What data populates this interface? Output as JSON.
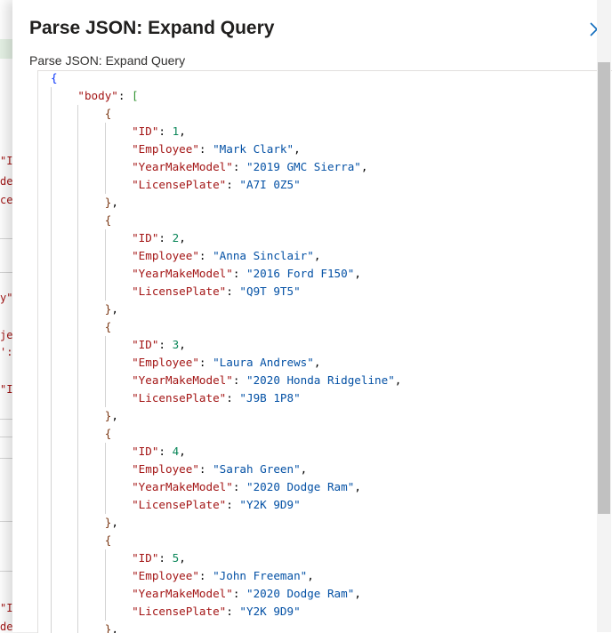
{
  "dialog": {
    "title": "Parse JSON: Expand Query",
    "field_label": "Parse JSON: Expand Query",
    "close_icon": "close-icon"
  },
  "background_fragments": [
    "\"I",
    "de",
    "ce",
    "y\"",
    "je",
    "':",
    "\"I",
    "\"I",
    "de"
  ],
  "editor": {
    "root_key": "\"body\"",
    "records": [
      {
        "id": "1",
        "employee": "\"Mark Clark\"",
        "ymm": "\"2019 GMC Sierra\"",
        "plate": "\"A7I 0Z5\""
      },
      {
        "id": "2",
        "employee": "\"Anna Sinclair\"",
        "ymm": "\"2016 Ford F150\"",
        "plate": "\"Q9T 9T5\""
      },
      {
        "id": "3",
        "employee": "\"Laura Andrews\"",
        "ymm": "\"2020 Honda Ridgeline\"",
        "plate": "\"J9B 1P8\""
      },
      {
        "id": "4",
        "employee": "\"Sarah Green\"",
        "ymm": "\"2020 Dodge Ram\"",
        "plate": "\"Y2K 9D9\""
      },
      {
        "id": "5",
        "employee": "\"John Freeman\"",
        "ymm": "\"2020 Dodge Ram\"",
        "plate": "\"Y2K 9D9\""
      }
    ],
    "keys": {
      "id": "\"ID\"",
      "employee": "\"Employee\"",
      "ymm": "\"YearMakeModel\"",
      "plate": "\"LicensePlate\""
    }
  }
}
